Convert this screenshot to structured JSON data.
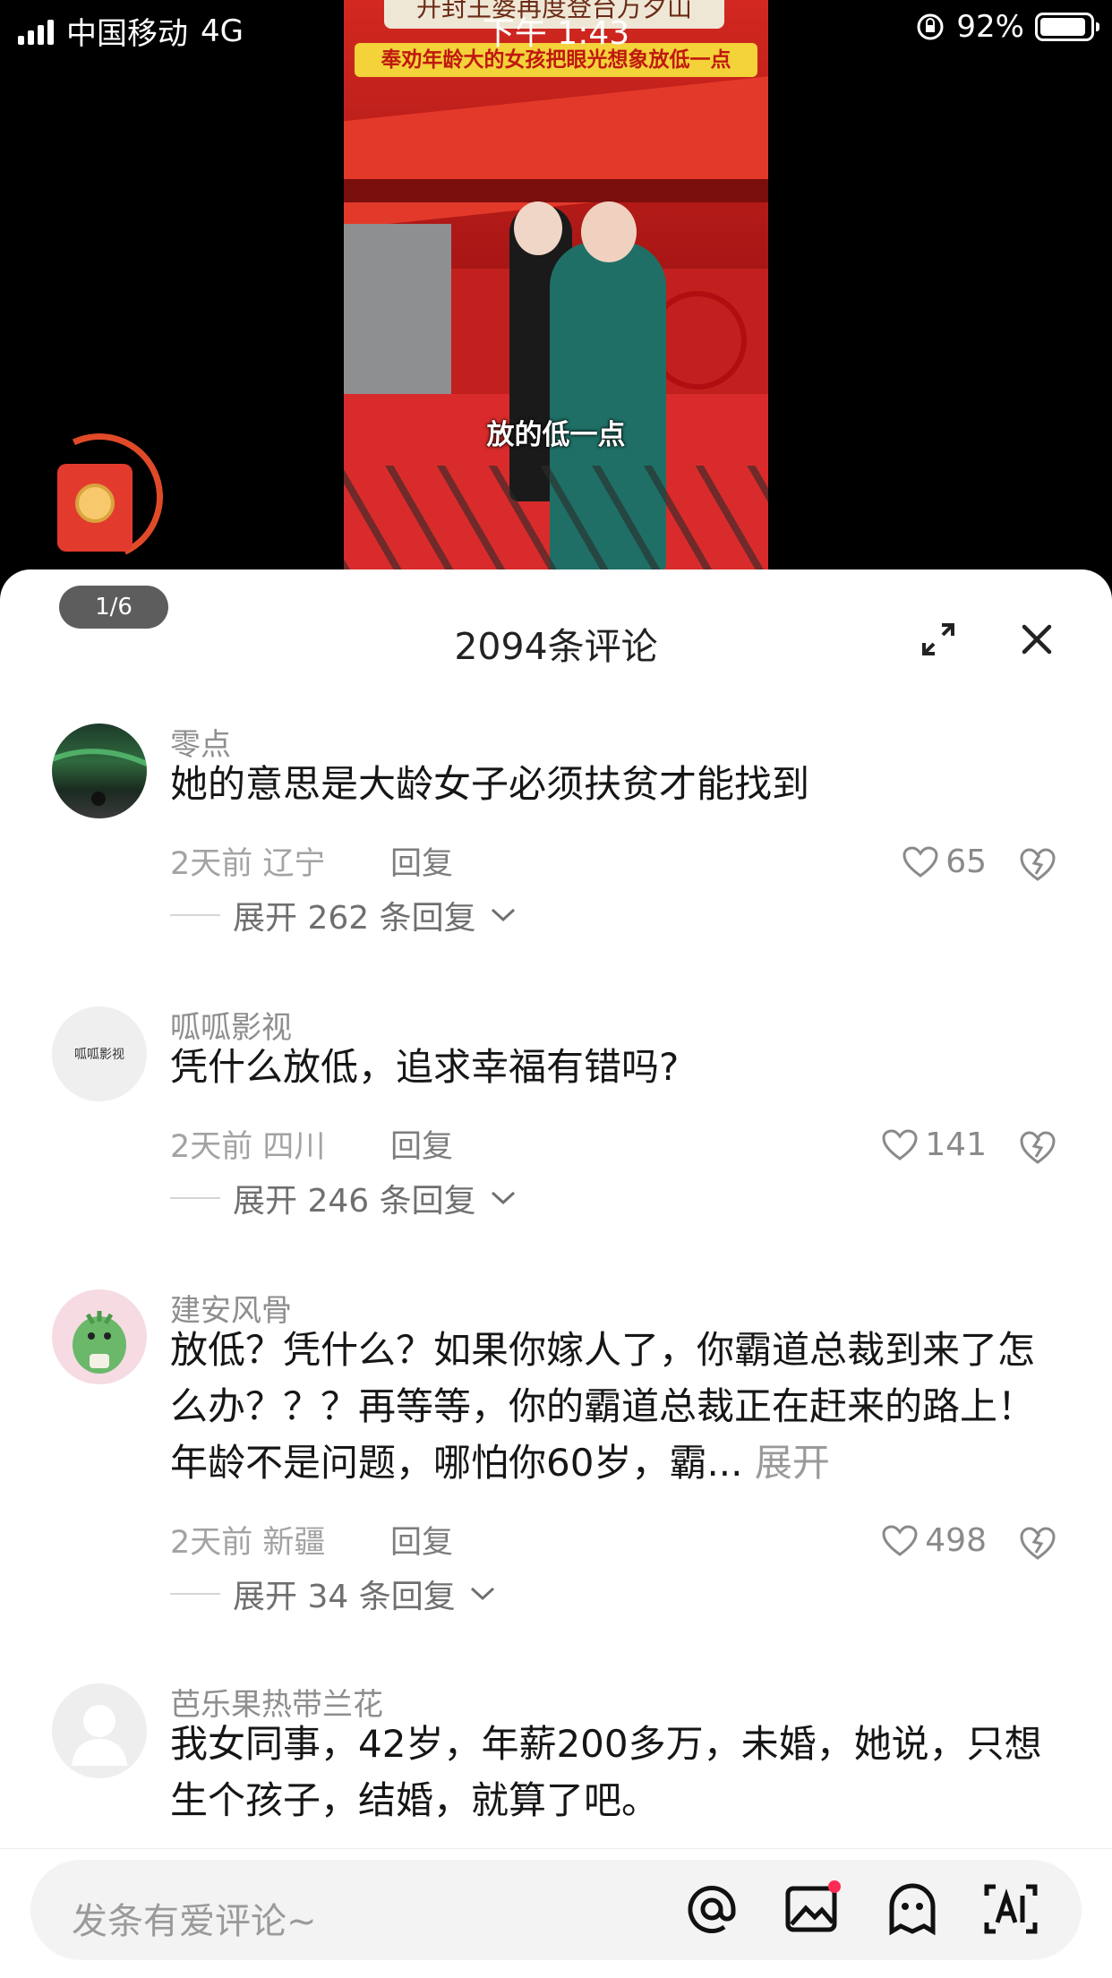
{
  "status_bar": {
    "carrier": "中国移动",
    "network": "4G",
    "time": "下午 1:43",
    "battery": "92%"
  },
  "video": {
    "top_caption": "开封王婆再度登台万夕山",
    "banner": "奉劝年龄大的女孩把眼光想象放低一点",
    "subtitle": "放的低一点",
    "page_indicator": "1/6"
  },
  "comments_sheet": {
    "title": "2094条评论",
    "comments": [
      {
        "user": "零点",
        "text": "她的意思是大龄女子必须扶贫才能找到",
        "meta": "2天前 辽宁",
        "reply_label": "回复",
        "likes": "65",
        "replies": "展开 262 条回复"
      },
      {
        "user": "呱呱影视",
        "avatar_text": "呱呱影视",
        "text": "凭什么放低，追求幸福有错吗?",
        "meta": "2天前 四川",
        "reply_label": "回复",
        "likes": "141",
        "replies": "展开 246 条回复"
      },
      {
        "user": "建安风骨",
        "text": "放低？凭什么？如果你嫁人了，你霸道总裁到来了怎么办？？？再等等，你的霸道总裁正在赶来的路上！年龄不是问题，哪怕你60岁，霸...",
        "expand": "展开",
        "meta": "2天前 新疆",
        "reply_label": "回复",
        "likes": "498",
        "replies": "展开 34 条回复"
      },
      {
        "user": "芭乐果热带兰花",
        "text": "我女同事，42岁，年薪200多万，未婚，她说，只想生个孩子，结婚，就算了吧。"
      }
    ]
  },
  "input": {
    "placeholder": "发条有爱评论~"
  },
  "icons": [
    "expand-icon",
    "close-icon",
    "heart-icon",
    "dislike-icon",
    "chevron-down-icon",
    "at-icon",
    "image-icon",
    "emoji-icon",
    "ai-icon"
  ],
  "colors": {
    "accent_red": "#e23b2e",
    "meta_gray": "#a3a3a3"
  }
}
